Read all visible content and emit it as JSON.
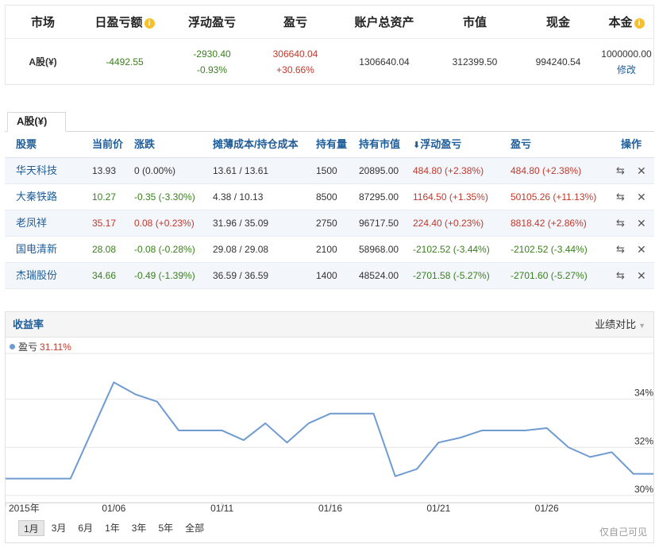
{
  "summary": {
    "headers": [
      "市场",
      "日盈亏额",
      "浮动盈亏",
      "盈亏",
      "账户总资产",
      "市值",
      "现金",
      "本金"
    ],
    "market": "A股(¥)",
    "daily_pnl": "-4492.55",
    "float_pnl": "-2930.40",
    "float_pnl_pct": "-0.93%",
    "pnl": "306640.04",
    "pnl_pct": "+30.66%",
    "total_assets": "1306640.04",
    "market_value": "312399.50",
    "cash": "994240.54",
    "principal": "1000000.00",
    "modify_label": "修改"
  },
  "tab_label": "A股(¥)",
  "holdings": {
    "headers": {
      "stock": "股票",
      "price": "当前价",
      "change": "涨跌",
      "cost": "摊薄成本/持仓成本",
      "shares": "持有量",
      "value": "持有市值",
      "float_pnl": "浮动盈亏",
      "pnl": "盈亏",
      "ops": "操作"
    },
    "sort_icon": "arrow-down-icon",
    "rows": [
      {
        "stock": "华天科技",
        "price": "13.93",
        "change": "0 (0.00%)",
        "cost": "13.61 / 13.61",
        "shares": "1500",
        "value": "20895.00",
        "float_pnl": "484.80 (+2.38%)",
        "pnl": "484.80 (+2.38%)",
        "price_color": "neutral",
        "change_color": "neutral",
        "float_color": "red",
        "pnl_color": "red"
      },
      {
        "stock": "大秦铁路",
        "price": "10.27",
        "change": "-0.35 (-3.30%)",
        "cost": "4.38 / 10.13",
        "shares": "8500",
        "value": "87295.00",
        "float_pnl": "1164.50 (+1.35%)",
        "pnl": "50105.26 (+11.13%)",
        "price_color": "green",
        "change_color": "green",
        "float_color": "red",
        "pnl_color": "red"
      },
      {
        "stock": "老凤祥",
        "price": "35.17",
        "change": "0.08 (+0.23%)",
        "cost": "31.96 / 35.09",
        "shares": "2750",
        "value": "96717.50",
        "float_pnl": "224.40 (+0.23%)",
        "pnl": "8818.42 (+2.86%)",
        "price_color": "red",
        "change_color": "red",
        "float_color": "red",
        "pnl_color": "red"
      },
      {
        "stock": "国电清新",
        "price": "28.08",
        "change": "-0.08 (-0.28%)",
        "cost": "29.08 / 29.08",
        "shares": "2100",
        "value": "58968.00",
        "float_pnl": "-2102.52 (-3.44%)",
        "pnl": "-2102.52 (-3.44%)",
        "price_color": "green",
        "change_color": "green",
        "float_color": "green",
        "pnl_color": "green"
      },
      {
        "stock": "杰瑞股份",
        "price": "34.66",
        "change": "-0.49 (-1.39%)",
        "cost": "36.59 / 36.59",
        "shares": "1400",
        "value": "48524.00",
        "float_pnl": "-2701.58 (-5.27%)",
        "pnl": "-2701.60 (-5.27%)",
        "price_color": "green",
        "change_color": "green",
        "float_color": "green",
        "pnl_color": "green"
      }
    ]
  },
  "chart": {
    "title": "收益率",
    "compare_label": "业绩对比",
    "legend_name": "盈亏",
    "legend_value": "31.11%",
    "range_buttons": [
      "1月",
      "3月",
      "6月",
      "1年",
      "3年",
      "5年",
      "全部"
    ],
    "active_range": "1月",
    "private_note": "仅自己可见"
  },
  "chart_data": {
    "type": "line",
    "series": [
      {
        "name": "盈亏",
        "x": [
          "2015-01-01",
          "2015-01-02",
          "2015-01-03",
          "2015-01-04",
          "2015-01-05",
          "2015-01-06",
          "2015-01-07",
          "2015-01-08",
          "2015-01-09",
          "2015-01-10",
          "2015-01-11",
          "2015-01-12",
          "2015-01-13",
          "2015-01-14",
          "2015-01-15",
          "2015-01-16",
          "2015-01-17",
          "2015-01-18",
          "2015-01-19",
          "2015-01-20",
          "2015-01-21",
          "2015-01-22",
          "2015-01-23",
          "2015-01-24",
          "2015-01-25",
          "2015-01-26",
          "2015-01-27",
          "2015-01-28",
          "2015-01-29",
          "2015-01-30",
          "2015-01-31"
        ],
        "values": [
          30.7,
          30.7,
          30.7,
          30.7,
          32.7,
          34.7,
          34.2,
          33.9,
          32.7,
          32.7,
          32.7,
          32.3,
          33.0,
          32.2,
          33.0,
          33.4,
          33.4,
          33.4,
          30.8,
          31.1,
          32.2,
          32.4,
          32.7,
          32.7,
          32.7,
          32.8,
          32.0,
          31.6,
          31.8,
          30.9,
          30.9
        ]
      }
    ],
    "x_tick_labels": [
      "2015年",
      "01/06",
      "01/11",
      "01/16",
      "01/21",
      "01/26"
    ],
    "x_tick_dates": [
      "2015-01-01",
      "2015-01-06",
      "2015-01-11",
      "2015-01-16",
      "2015-01-21",
      "2015-01-26"
    ],
    "y_ticks": [
      30,
      32,
      34
    ],
    "y_tick_labels": [
      "30%",
      "32%",
      "34%"
    ],
    "ylim": [
      29.7,
      35.9
    ],
    "line_color": "#6f9bd1",
    "grid": true
  }
}
